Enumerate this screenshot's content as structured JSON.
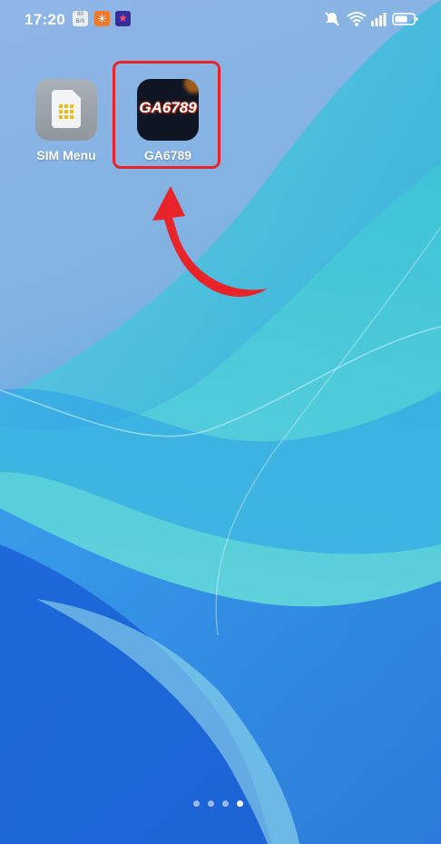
{
  "status_bar": {
    "time": "17:20",
    "notifications": [
      {
        "icon": "data-speed-icon",
        "text": "80\nB/S"
      },
      {
        "icon": "app-orange-icon",
        "text": "✳"
      },
      {
        "icon": "app-star-icon",
        "text": "★"
      }
    ],
    "icons": [
      "mute-vibrate-icon",
      "wifi-icon",
      "signal-icon",
      "battery-icon"
    ]
  },
  "apps": [
    {
      "name": "sim-menu",
      "label": "SIM Menu"
    },
    {
      "name": "ga6789",
      "label": "GA6789",
      "icon_text": "GA6789"
    }
  ],
  "pager": {
    "pages": 4,
    "current": 4
  },
  "colors": {
    "highlight": "#e8242a",
    "arrow": "#e8242a"
  }
}
